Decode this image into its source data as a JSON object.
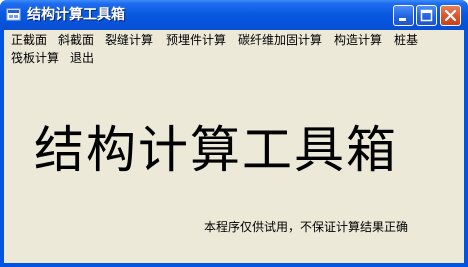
{
  "window": {
    "title": "结构计算工具箱",
    "icon": "app-icon",
    "controls": [
      "minimize-icon",
      "maximize-icon",
      "close-icon"
    ]
  },
  "menu": {
    "items": [
      "正截面",
      "斜截面",
      "裂缝计算",
      "预埋件计算",
      "碳纤维加固计算",
      "构造计算",
      "桩基",
      "筏板计算",
      "退出"
    ]
  },
  "main": {
    "title": "结构计算工具箱",
    "disclaimer": "本程序仅供试用，不保证计算结果正确"
  },
  "colors": {
    "titlebar": "#0a5ae0",
    "client_background": "#ece9d8",
    "close_button": "#d8542c"
  }
}
